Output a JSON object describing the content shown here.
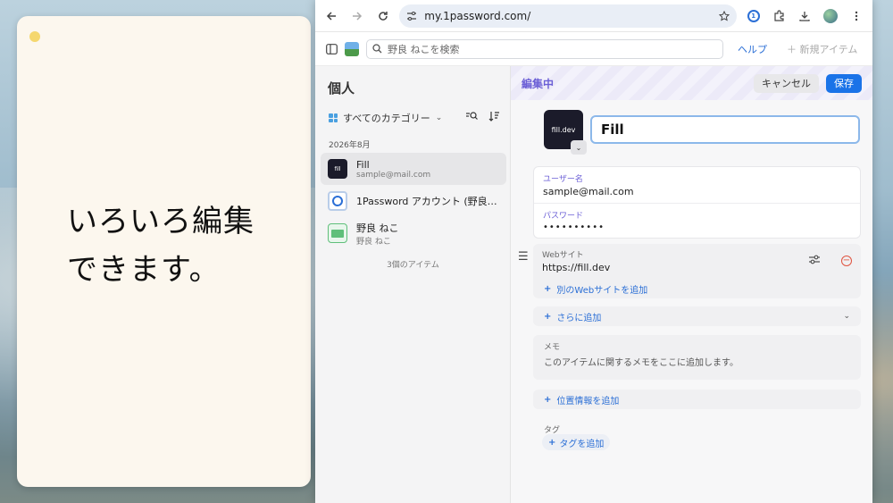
{
  "note": {
    "text": "いろいろ編集\nできます。"
  },
  "browser": {
    "url": "my.1password.com/"
  },
  "app": {
    "search_placeholder": "野良 ねこを検索",
    "help_label": "ヘルプ",
    "new_item_label": "新規アイテム"
  },
  "sidebar": {
    "vault_title": "個人",
    "category_label": "すべてのカテゴリー",
    "month_header": "2026年8月",
    "items": [
      {
        "title": "Fill",
        "subtitle": "sample@mail.com",
        "icon": "fill-logo"
      },
      {
        "title": "1Password アカウント (野良 ね...",
        "subtitle": "",
        "icon": "onepassword-logo"
      },
      {
        "title": "野良 ねこ",
        "subtitle": "野良 ねこ",
        "icon": "id-card-icon"
      }
    ],
    "item_count": "3個のアイテム"
  },
  "editor": {
    "header_title": "編集中",
    "cancel_label": "キャンセル",
    "save_label": "保存",
    "item_title": "Fill",
    "icon_label": "fill.dev",
    "username_label": "ユーザー名",
    "username_value": "sample@mail.com",
    "password_label": "パスワード",
    "password_value": "••••••••••",
    "website_label": "Webサイト",
    "website_value": "https://fill.dev",
    "add_website_label": "別のWebサイトを追加",
    "add_more_label": "さらに追加",
    "memo_label": "メモ",
    "memo_placeholder": "このアイテムに関するメモをここに追加します。",
    "add_location_label": "位置情報を追加",
    "tags_label": "タグ",
    "add_tag_label": "タグを追加"
  },
  "colors": {
    "accent": "#1a73e8",
    "editing_purple": "#6b5fd6",
    "remove_red": "#e0533f"
  }
}
